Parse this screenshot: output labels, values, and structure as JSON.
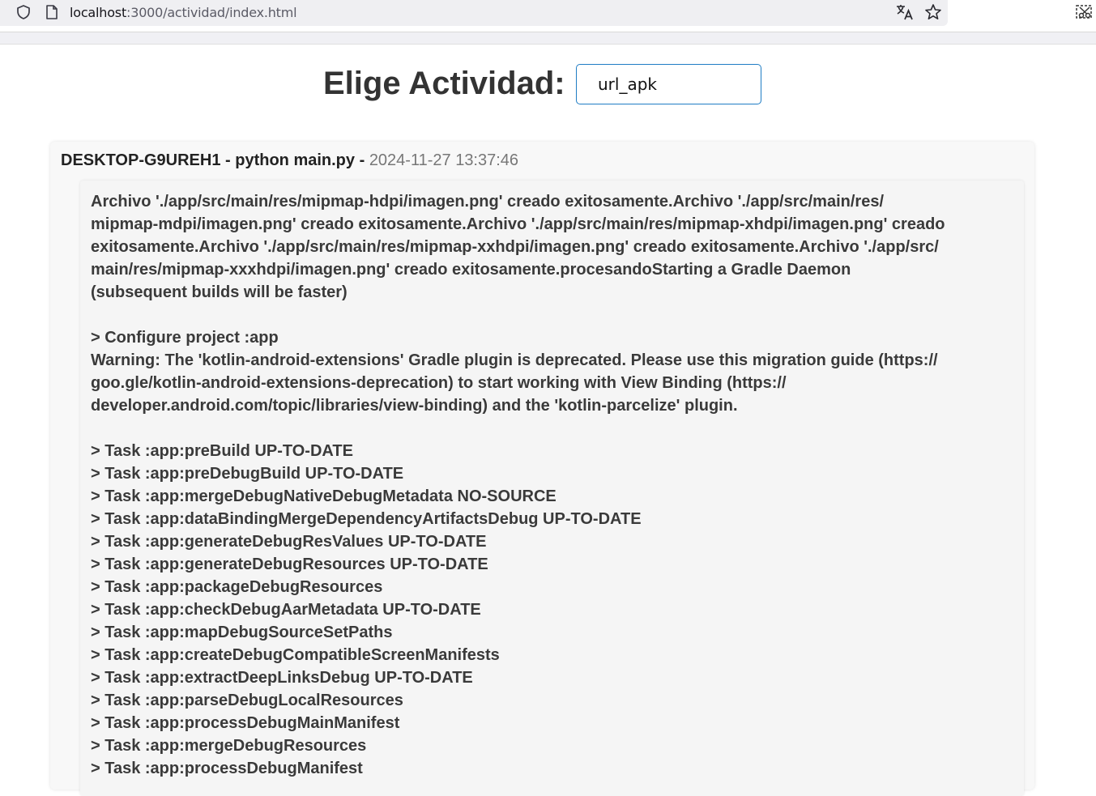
{
  "browser": {
    "url_host": "localhost",
    "url_rest": ":3000/actividad/index.html"
  },
  "page": {
    "title": "Elige Actividad:",
    "activity_value": "url_apk"
  },
  "entry": {
    "host": "DESKTOP-G9UREH1",
    "separator1": " - ",
    "command": "python main.py",
    "separator2": " - ",
    "timestamp": "2024-11-27 13:37:46",
    "lines": [
      "Archivo './app/src/main/res/mipmap-hdpi/imagen.png' creado exitosamente.Archivo './app/src/main/res/",
      "mipmap-mdpi/imagen.png' creado exitosamente.Archivo './app/src/main/res/mipmap-xhdpi/imagen.png' creado",
      "exitosamente.Archivo './app/src/main/res/mipmap-xxhdpi/imagen.png' creado exitosamente.Archivo './app/src/",
      "main/res/mipmap-xxxhdpi/imagen.png' creado exitosamente.procesandoStarting a Gradle Daemon",
      "(subsequent builds will be faster)",
      "",
      "> Configure project :app",
      "Warning: The 'kotlin-android-extensions' Gradle plugin is deprecated. Please use this migration guide (https://",
      "goo.gle/kotlin-android-extensions-deprecation) to start working with View Binding (https://",
      "developer.android.com/topic/libraries/view-binding) and the 'kotlin-parcelize' plugin.",
      "",
      "> Task :app:preBuild UP-TO-DATE",
      "> Task :app:preDebugBuild UP-TO-DATE",
      "> Task :app:mergeDebugNativeDebugMetadata NO-SOURCE",
      "> Task :app:dataBindingMergeDependencyArtifactsDebug UP-TO-DATE",
      "> Task :app:generateDebugResValues UP-TO-DATE",
      "> Task :app:generateDebugResources UP-TO-DATE",
      "> Task :app:packageDebugResources",
      "> Task :app:checkDebugAarMetadata UP-TO-DATE",
      "> Task :app:mapDebugSourceSetPaths",
      "> Task :app:createDebugCompatibleScreenManifests",
      "> Task :app:extractDeepLinksDebug UP-TO-DATE",
      "> Task :app:parseDebugLocalResources",
      "> Task :app:processDebugMainManifest",
      "> Task :app:mergeDebugResources",
      "> Task :app:processDebugManifest"
    ]
  },
  "icons": {
    "shield": "shield-icon",
    "page": "page-icon",
    "translate": "translate-icon",
    "star": "bookmark-star-icon",
    "extension": "screenshot-extension-icon"
  }
}
